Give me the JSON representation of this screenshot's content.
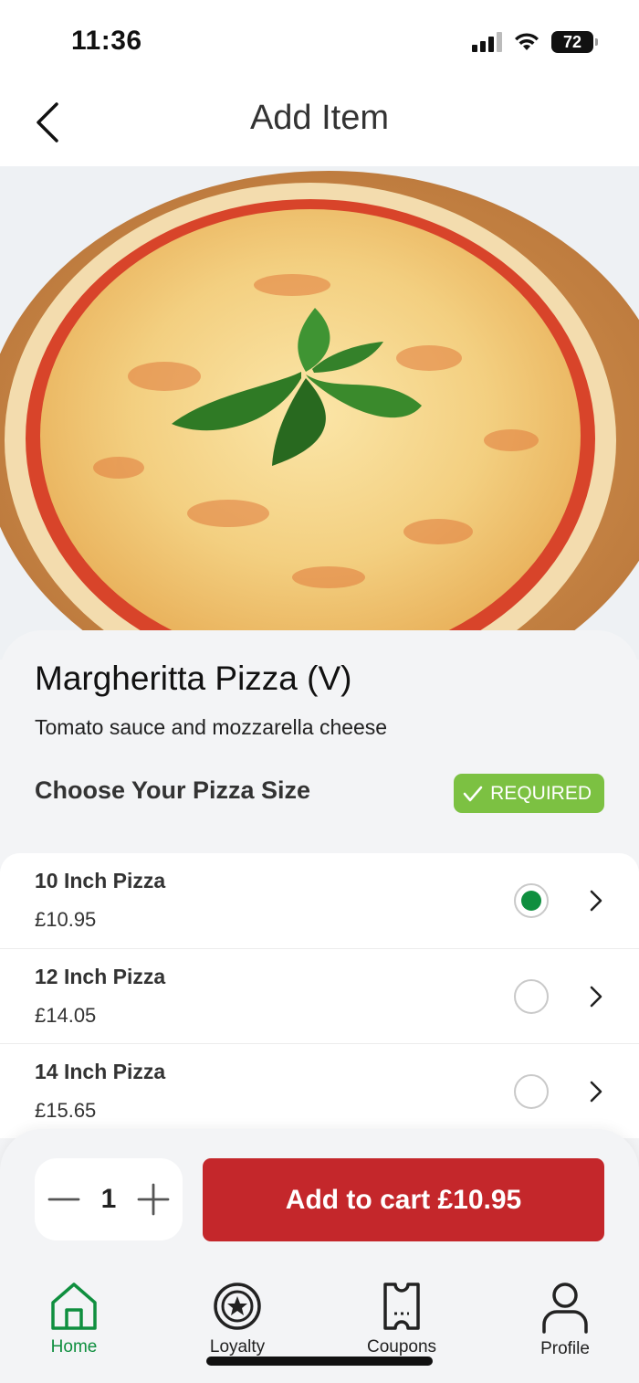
{
  "status_bar": {
    "time": "11:36",
    "battery": "72"
  },
  "header": {
    "title": "Add Item"
  },
  "hero": {
    "image": "margherita-pizza-photo"
  },
  "item": {
    "name": "Margheritta Pizza (V)",
    "description": "Tomato sauce and mozzarella cheese"
  },
  "size_section": {
    "title": "Choose Your Pizza Size",
    "badge": "REQUIRED",
    "options": [
      {
        "name": "10 Inch Pizza",
        "price": "£10.95",
        "selected": true
      },
      {
        "name": "12 Inch Pizza",
        "price": "£14.05",
        "selected": false
      },
      {
        "name": "14 Inch Pizza",
        "price": "£15.65",
        "selected": false
      }
    ]
  },
  "quantity": {
    "value": "1"
  },
  "cart_button": {
    "label": "Add to cart £10.95"
  },
  "tabs": [
    {
      "label": "Home",
      "icon": "home-icon",
      "active": true
    },
    {
      "label": "Loyalty",
      "icon": "loyalty-star-icon",
      "active": false
    },
    {
      "label": "Coupons",
      "icon": "coupon-ticket-icon",
      "active": false
    },
    {
      "label": "Profile",
      "icon": "profile-icon",
      "active": false
    }
  ],
  "colors": {
    "accent_green": "#0f8f3f",
    "required_green": "#7cc142",
    "cart_red": "#c4272b"
  }
}
